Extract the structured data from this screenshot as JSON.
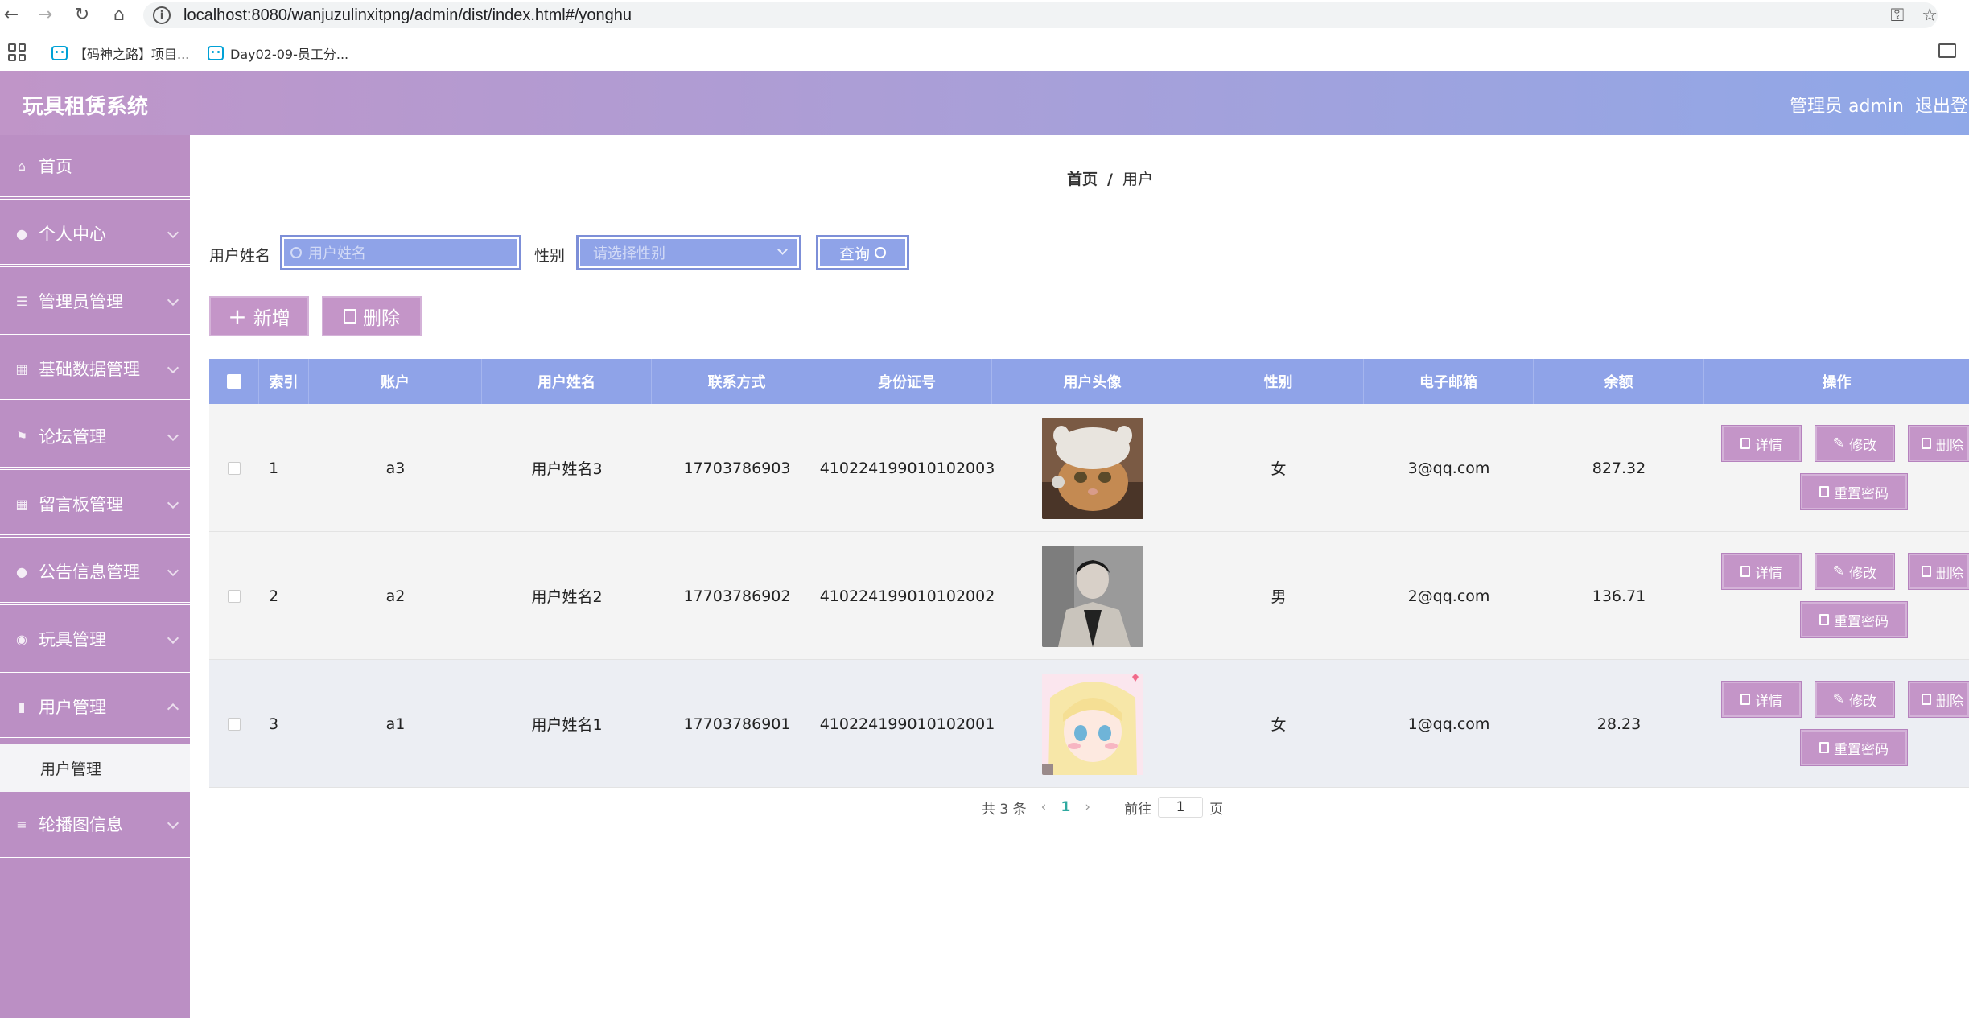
{
  "browser": {
    "url": "localhost:8080/wanjuzulinxitpng/admin/dist/index.html#/yonghu",
    "bookmarks": [
      "【码神之路】项目...",
      "Day02-09-员工分..."
    ]
  },
  "header": {
    "title": "玩具租赁系统",
    "admin": "管理员 admin",
    "logout": "退出登录"
  },
  "sidebar": {
    "items": [
      {
        "label": "首页",
        "icon": "home-icon"
      },
      {
        "label": "个人中心",
        "icon": "user-icon"
      },
      {
        "label": "管理员管理",
        "icon": "sliders-icon"
      },
      {
        "label": "基础数据管理",
        "icon": "grid-icon"
      },
      {
        "label": "论坛管理",
        "icon": "flag-icon"
      },
      {
        "label": "留言板管理",
        "icon": "grid-icon"
      },
      {
        "label": "公告信息管理",
        "icon": "user-icon"
      },
      {
        "label": "玩具管理",
        "icon": "location-icon"
      },
      {
        "label": "用户管理",
        "icon": "chart-icon"
      },
      {
        "label": "轮播图信息",
        "icon": "menu-icon"
      }
    ],
    "sub_item": "用户管理"
  },
  "breadcrumb": {
    "home": "首页",
    "sep": "/",
    "current": "用户"
  },
  "search": {
    "name_label": "用户姓名",
    "name_placeholder": "用户姓名",
    "gender_label": "性别",
    "gender_placeholder": "请选择性别",
    "query_label": "查询"
  },
  "actions": {
    "add": "新增",
    "delete": "删除"
  },
  "table": {
    "headers": [
      "索引",
      "账户",
      "用户姓名",
      "联系方式",
      "身份证号",
      "用户头像",
      "性别",
      "电子邮箱",
      "余额",
      "操作"
    ],
    "rows": [
      {
        "index": "1",
        "account": "a3",
        "name": "用户姓名3",
        "phone": "17703786903",
        "id_card": "410224199010102003",
        "gender": "女",
        "email": "3@qq.com",
        "balance": "827.32"
      },
      {
        "index": "2",
        "account": "a2",
        "name": "用户姓名2",
        "phone": "17703786902",
        "id_card": "410224199010102002",
        "gender": "男",
        "email": "2@qq.com",
        "balance": "136.71"
      },
      {
        "index": "3",
        "account": "a1",
        "name": "用户姓名1",
        "phone": "17703786901",
        "id_card": "410224199010102001",
        "gender": "女",
        "email": "1@qq.com",
        "balance": "28.23"
      }
    ],
    "ops": {
      "detail": "详情",
      "edit": "修改",
      "delete": "删除",
      "reset": "重置密码"
    }
  },
  "pager": {
    "total": "共 3 条",
    "current": "1",
    "goto_prefix": "前往",
    "goto_value": "1",
    "goto_suffix": "页"
  }
}
